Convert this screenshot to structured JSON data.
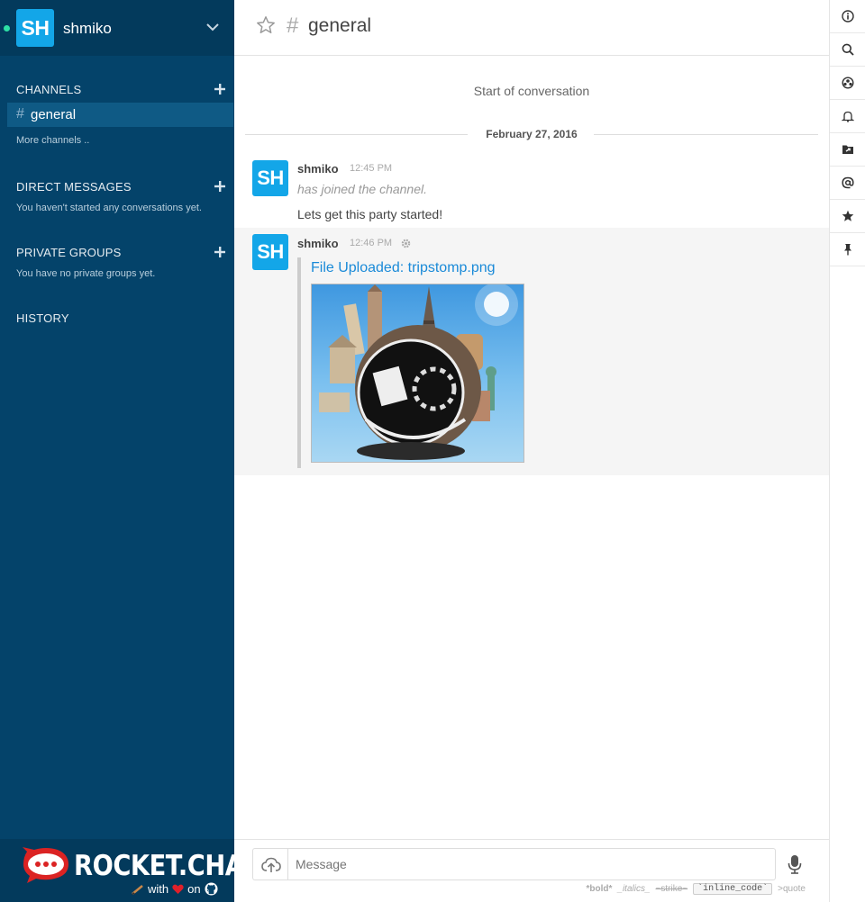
{
  "user": {
    "name": "shmiko",
    "initials": "SH",
    "status": "online"
  },
  "sidebar": {
    "channels_title": "CHANNELS",
    "channels": [
      {
        "hash": "#",
        "name": "general"
      }
    ],
    "more_channels": "More channels ..",
    "direct_messages_title": "DIRECT MESSAGES",
    "direct_messages_empty": "You haven't started any conversations yet.",
    "private_groups_title": "PRIVATE GROUPS",
    "private_groups_empty": "You have no private groups yet.",
    "history_title": "HISTORY"
  },
  "footer": {
    "logo_text": "ROCKET.CHAT",
    "with_label": "with",
    "on_label": "on"
  },
  "room": {
    "hash": "#",
    "name": "general"
  },
  "conversation": {
    "start_label": "Start of conversation",
    "date_separator": "February 27, 2016",
    "messages": [
      {
        "avatar": "SH",
        "user": "shmiko",
        "time": "12:45 PM",
        "system": "has joined the channel.",
        "text": "Lets get this party started!"
      },
      {
        "avatar": "SH",
        "user": "shmiko",
        "time": "12:46 PM",
        "attachment_title": "File Uploaded: tripstomp.png"
      }
    ]
  },
  "composer": {
    "placeholder": "Message",
    "hints": {
      "bold": "*bold*",
      "italics": "_italics_",
      "strike": "~strike~",
      "code": "`inline_code`",
      "quote": ">quote"
    }
  },
  "toolbar": [
    "info-icon",
    "search-icon",
    "members-icon",
    "notifications-icon",
    "files-icon",
    "mentions-icon",
    "starred-icon",
    "pinned-icon"
  ],
  "colors": {
    "sidebar": "#04436a",
    "avatar": "#13a6e8",
    "link": "#1a8ad8",
    "online": "#2de0a5"
  }
}
